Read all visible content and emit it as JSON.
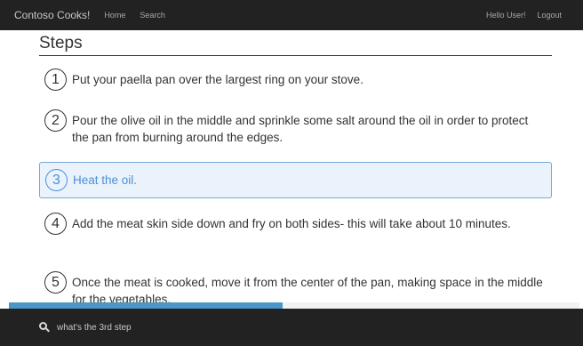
{
  "navbar": {
    "brand": "Contoso Cooks!",
    "links": [
      "Home",
      "Search"
    ],
    "greeting": "Hello User!",
    "logout": "Logout"
  },
  "page": {
    "title": "Steps"
  },
  "steps": [
    {
      "number": "1",
      "text": "Put your paella pan over the largest ring on your stove."
    },
    {
      "number": "2",
      "text": "Pour the olive oil in the middle and sprinkle some salt around the oil in order to protect the pan from burning around the edges."
    },
    {
      "number": "3",
      "text": "Heat the oil.",
      "active": true
    },
    {
      "number": "4",
      "text": "Add the meat skin side down and fry on both sides- this will take about 10 minutes."
    },
    {
      "number": "5",
      "text": "Once the meat is cooked, move it from the center of the pan, making space in the middle for the vegetables."
    }
  ],
  "progress": {
    "fraction": 0.48
  },
  "search": {
    "query": "what's the 3rd step"
  },
  "colors": {
    "accent": "#4a90d9",
    "active_bg": "#eaf3fc",
    "navbar_bg": "#222222",
    "progress_fill": "#4b96c8"
  },
  "icons": {
    "search": "search-icon"
  }
}
